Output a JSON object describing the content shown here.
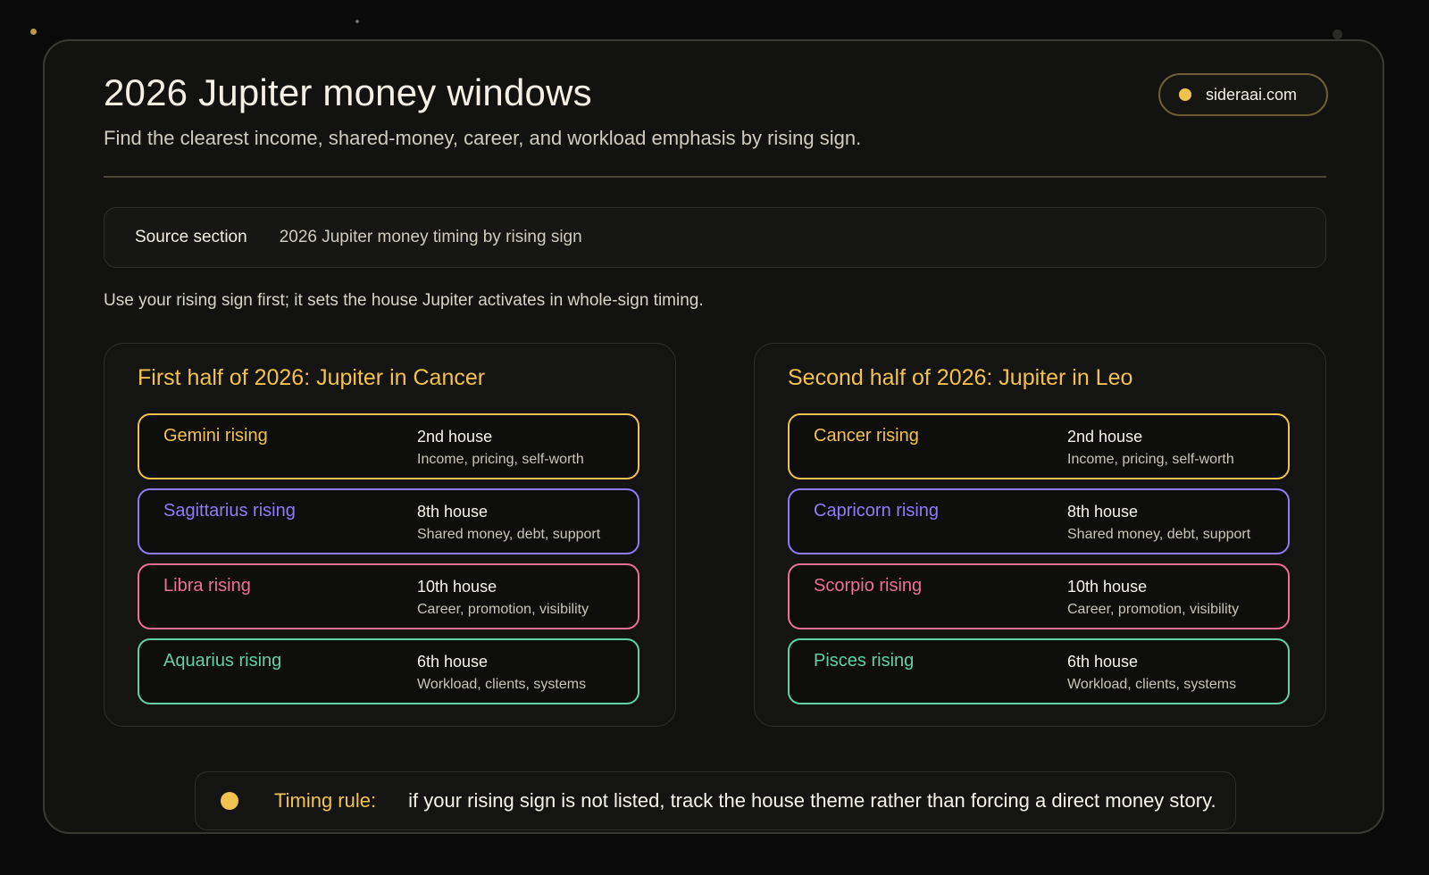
{
  "header": {
    "title": "2026 Jupiter money windows",
    "subtitle": "Find the clearest income, shared-money, career, and workload emphasis by rising sign.",
    "site": "sideraai.com"
  },
  "source": {
    "label": "Source section",
    "value": "2026 Jupiter money timing by rising sign"
  },
  "intro": "Use your rising sign first; it sets the house Jupiter activates in whole-sign timing.",
  "colors": {
    "accent": "#f2c24e",
    "income": "#f2c24e",
    "shared": "#8f7cf5",
    "career": "#ef6f9a",
    "workload": "#63cfa9"
  },
  "halves": [
    {
      "title": "First half of 2026: Jupiter in Cancer",
      "rows": [
        {
          "sign": "Gemini rising",
          "house": "2nd house",
          "theme": "Income, pricing, self-worth",
          "color": "#f2c24e"
        },
        {
          "sign": "Sagittarius rising",
          "house": "8th house",
          "theme": "Shared money, debt, support",
          "color": "#8f7cf5"
        },
        {
          "sign": "Libra rising",
          "house": "10th house",
          "theme": "Career, promotion, visibility",
          "color": "#ef6f9a"
        },
        {
          "sign": "Aquarius rising",
          "house": "6th house",
          "theme": "Workload, clients, systems",
          "color": "#63cfa9"
        }
      ]
    },
    {
      "title": "Second half of 2026: Jupiter in Leo",
      "rows": [
        {
          "sign": "Cancer rising",
          "house": "2nd house",
          "theme": "Income, pricing, self-worth",
          "color": "#f2c24e"
        },
        {
          "sign": "Capricorn rising",
          "house": "8th house",
          "theme": "Shared money, debt, support",
          "color": "#8f7cf5"
        },
        {
          "sign": "Scorpio rising",
          "house": "10th house",
          "theme": "Career, promotion, visibility",
          "color": "#ef6f9a"
        },
        {
          "sign": "Pisces rising",
          "house": "6th house",
          "theme": "Workload, clients, systems",
          "color": "#63cfa9"
        }
      ]
    }
  ],
  "footer": {
    "label": "Timing rule:",
    "text": "if your rising sign is not listed, track the house theme rather than forcing a direct money story."
  }
}
